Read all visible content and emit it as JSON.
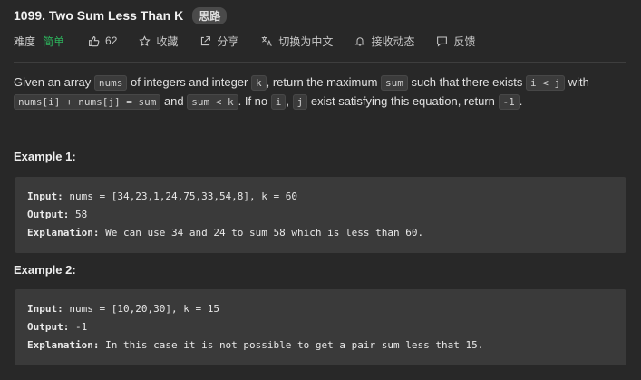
{
  "problem": {
    "title": "1099. Two Sum Less Than K",
    "badge": "思路"
  },
  "meta": {
    "difficulty_label": "难度",
    "difficulty_value": "简单",
    "likes": "62",
    "favorite": "收藏",
    "share": "分享",
    "translate": "切换为中文",
    "subscribe": "接收动态",
    "feedback": "反馈",
    "colors": {
      "easy": "#2db55d"
    }
  },
  "description": {
    "t1": "Given an array ",
    "c1": "nums",
    "t2": " of integers and integer ",
    "c2": "k",
    "t3": ", return the maximum ",
    "c3": "sum",
    "t4": " such that there exists ",
    "c4": "i < j",
    "t5": " with ",
    "c5": "nums[i] + nums[j] = sum",
    "t6": " and ",
    "c6": "sum < k",
    "t7": ". If no ",
    "c7": "i",
    "t8": ", ",
    "c8": "j",
    "t9": " exist satisfying this equation, return ",
    "c9": "-1",
    "t10": "."
  },
  "examples": [
    {
      "title": "Example 1:",
      "input_label": "Input:",
      "input": "nums = [34,23,1,24,75,33,54,8], k = 60",
      "output_label": "Output:",
      "output": "58",
      "explanation_label": "Explanation:",
      "explanation": "We can use 34 and 24 to sum 58 which is less than 60."
    },
    {
      "title": "Example 2:",
      "input_label": "Input:",
      "input": "nums = [10,20,30], k = 15",
      "output_label": "Output:",
      "output": "-1",
      "explanation_label": "Explanation:",
      "explanation": "In this case it is not possible to get a pair sum less that 15."
    }
  ]
}
